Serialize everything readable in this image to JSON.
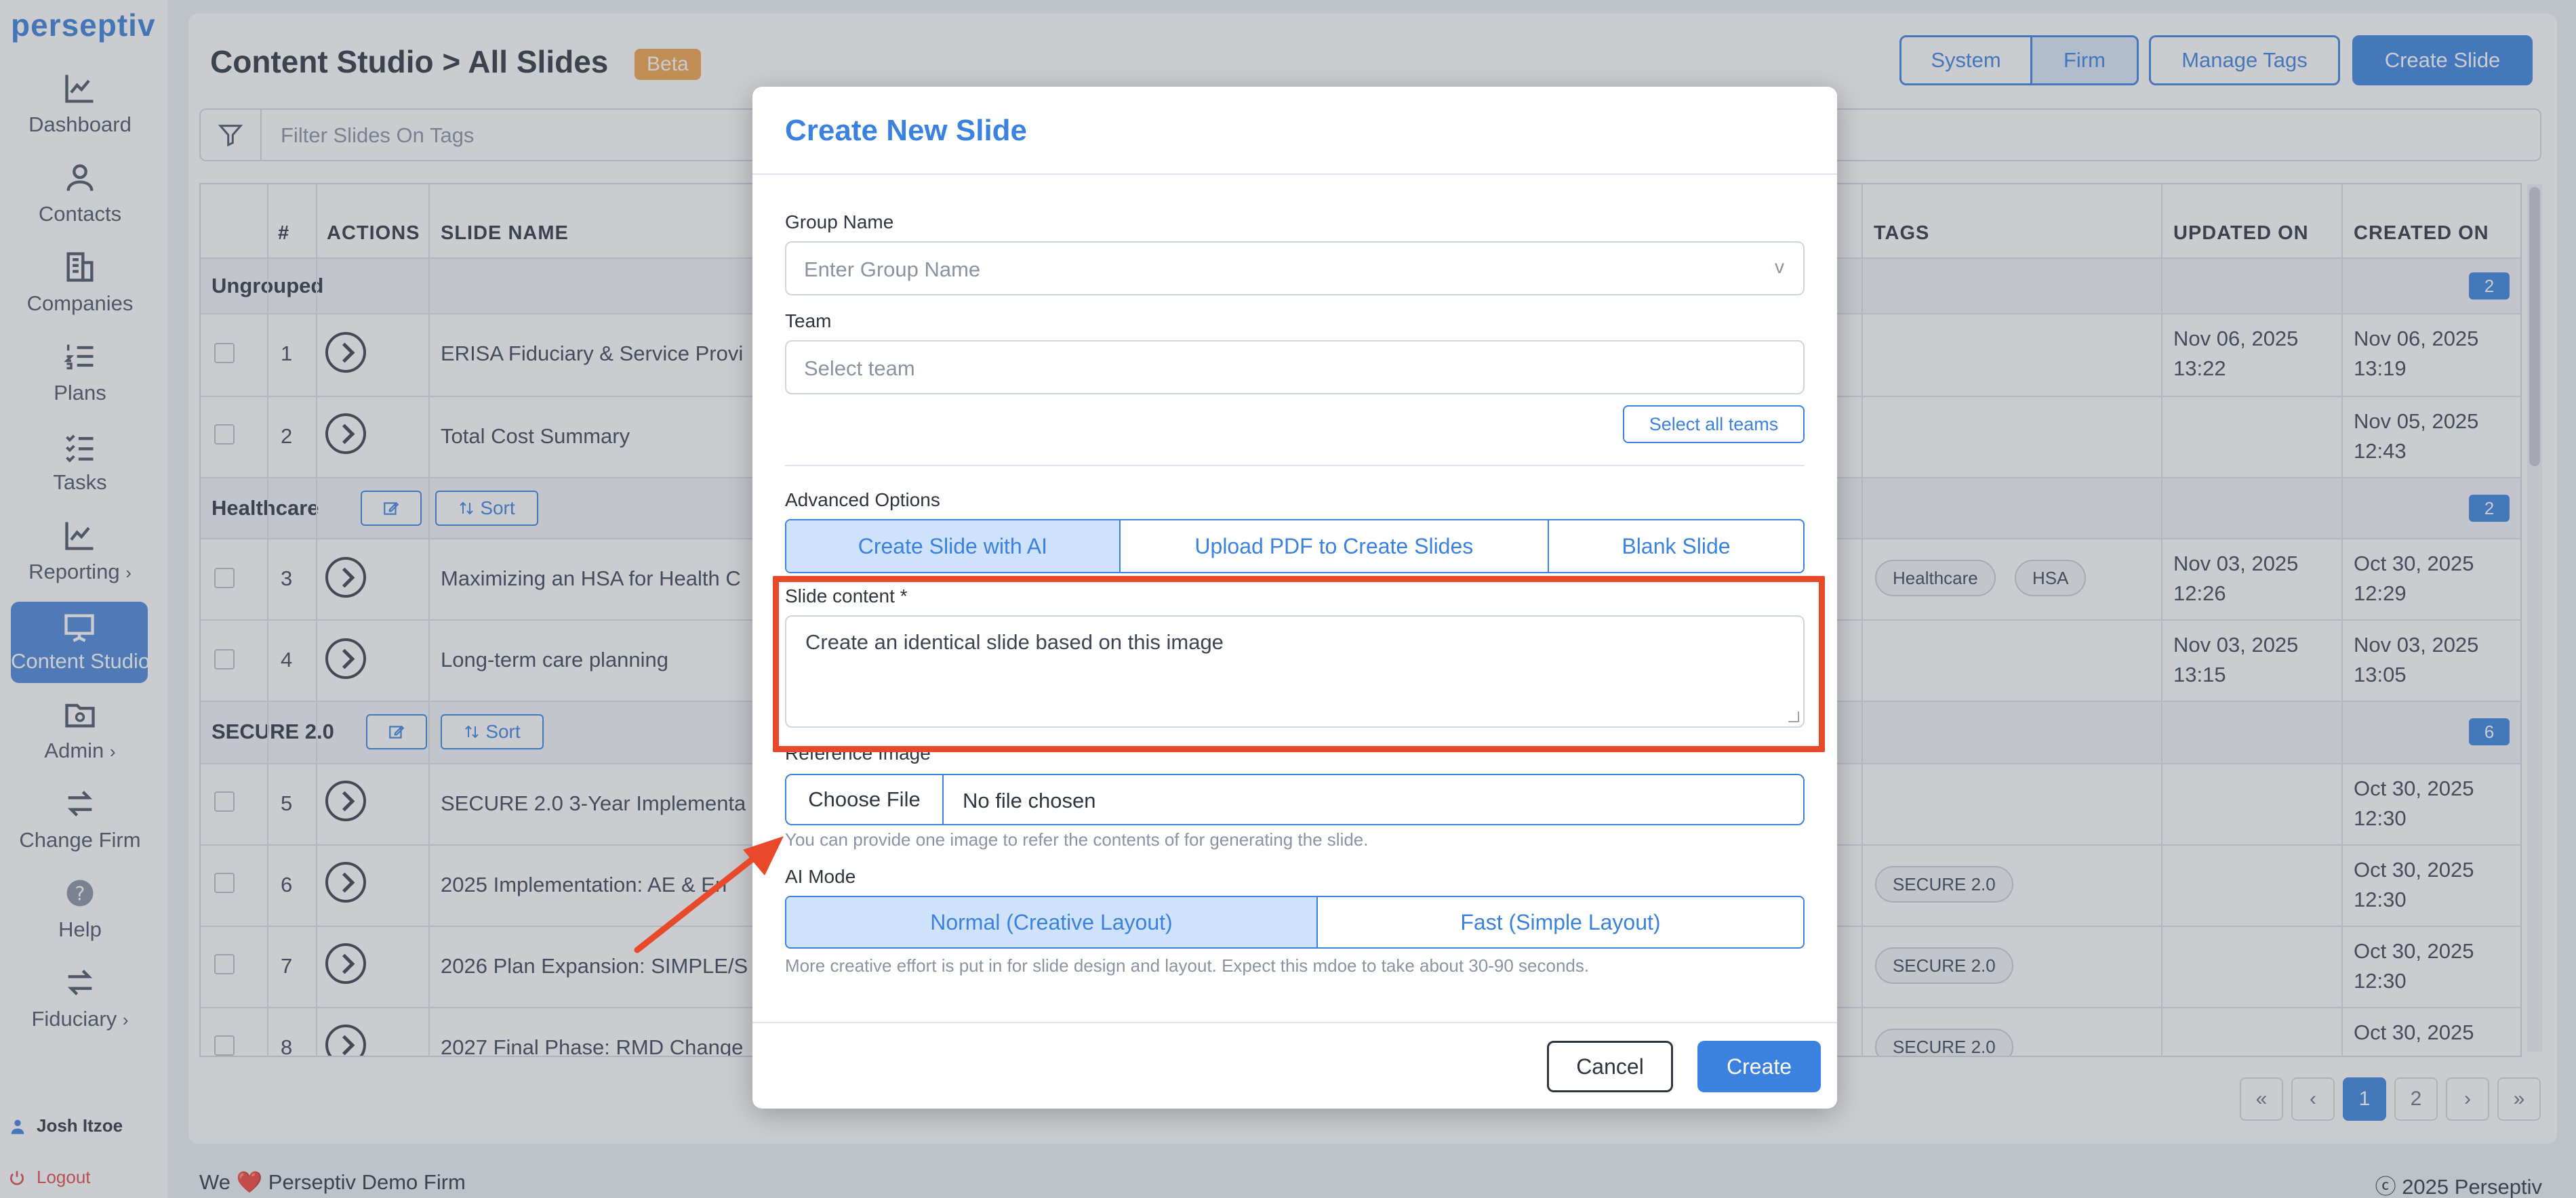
{
  "sidebar": {
    "logo": "perseptiv",
    "items": [
      {
        "label": "Dashboard",
        "icon": "chart-line-icon",
        "chevron": ""
      },
      {
        "label": "Contacts",
        "icon": "user-icon",
        "chevron": ""
      },
      {
        "label": "Companies",
        "icon": "building-icon",
        "chevron": ""
      },
      {
        "label": "Plans",
        "icon": "list-numbered-icon",
        "chevron": ""
      },
      {
        "label": "Tasks",
        "icon": "checklist-icon",
        "chevron": ""
      },
      {
        "label": "Reporting",
        "icon": "chart-line-icon",
        "chevron": "›"
      },
      {
        "label": "Content Studio",
        "icon": "presentation-icon",
        "chevron": ""
      },
      {
        "label": "Admin",
        "icon": "folder-gear-icon",
        "chevron": "›"
      },
      {
        "label": "Change Firm",
        "icon": "swap-arrows-icon",
        "chevron": ""
      },
      {
        "label": "Help",
        "icon": "question-circle-icon",
        "chevron": ""
      },
      {
        "label": "Fiduciary",
        "icon": "swap-arrows-icon",
        "chevron": "›"
      }
    ],
    "user": "Josh Itzoe",
    "logout": "Logout"
  },
  "header": {
    "title": "Content Studio > All Slides",
    "badge": "Beta",
    "buttons": {
      "system": "System",
      "firm": "Firm",
      "manage_tags": "Manage Tags",
      "create_slide": "Create Slide"
    }
  },
  "filter": {
    "placeholder": "Filter Slides On Tags"
  },
  "table": {
    "columns": {
      "num": "#",
      "actions": "ACTIONS",
      "slide_name": "SLIDE NAME",
      "tags": "TAGS",
      "updated_on": "UPDATED ON",
      "created_on": "CREATED ON"
    },
    "groups": [
      {
        "name": "Ungrouped",
        "count": "2"
      },
      {
        "name": "Healthcare",
        "count": "2",
        "sort": "Sort"
      },
      {
        "name": "SECURE 2.0",
        "count": "6",
        "sort": "Sort"
      }
    ],
    "rows": [
      {
        "num": "1",
        "name": "ERISA Fiduciary & Service Provi",
        "tags": [],
        "updated": [
          "Nov 06, 2025",
          "13:22"
        ],
        "created": [
          "Nov 06, 2025",
          "13:19"
        ]
      },
      {
        "num": "2",
        "name": "Total Cost Summary",
        "tags": [],
        "updated": [
          "",
          ""
        ],
        "created": [
          "Nov 05, 2025",
          "12:43"
        ]
      },
      {
        "num": "3",
        "name": "Maximizing an HSA for Health C",
        "tags": [
          "Healthcare",
          "HSA"
        ],
        "updated": [
          "Nov 03, 2025",
          "12:26"
        ],
        "created": [
          "Oct 30, 2025",
          "12:29"
        ]
      },
      {
        "num": "4",
        "name": "Long-term care planning",
        "tags": [],
        "updated": [
          "Nov 03, 2025",
          "13:15"
        ],
        "created": [
          "Nov 03, 2025",
          "13:05"
        ]
      },
      {
        "num": "5",
        "name": "SECURE 2.0 3-Year Implementa",
        "tags": [],
        "updated": [
          "",
          ""
        ],
        "created": [
          "Oct 30, 2025",
          "12:30"
        ]
      },
      {
        "num": "6",
        "name": "2025 Implementation: AE & En",
        "tags": [
          "SECURE 2.0"
        ],
        "updated": [
          "",
          ""
        ],
        "created": [
          "Oct 30, 2025",
          "12:30"
        ]
      },
      {
        "num": "7",
        "name": "2026 Plan Expansion: SIMPLE/S",
        "tags": [
          "SECURE 2.0"
        ],
        "updated": [
          "",
          ""
        ],
        "created": [
          "Oct 30, 2025",
          "12:30"
        ]
      },
      {
        "num": "8",
        "name": "2027 Final Phase: RMD Change",
        "tags": [
          "SECURE 2.0"
        ],
        "updated": [
          "",
          ""
        ],
        "created": [
          "Oct 30, 2025",
          ""
        ]
      }
    ]
  },
  "pagination": {
    "first": "«",
    "prev": "‹",
    "pages": [
      "1",
      "2"
    ],
    "next": "›",
    "last": "»"
  },
  "footer": {
    "left": "We ❤️ Perseptiv Demo Firm",
    "right": "ⓒ 2025 Perseptiv"
  },
  "modal": {
    "title": "Create New Slide",
    "group_label": "Group Name",
    "group_placeholder": "Enter Group Name",
    "group_caret": "v",
    "team_label": "Team",
    "team_placeholder": "Select team",
    "select_all_teams": "Select all teams",
    "advanced_label": "Advanced Options",
    "advanced_options": [
      "Create Slide with AI",
      "Upload PDF to Create Slides",
      "Blank Slide"
    ],
    "slide_content_label": "Slide content *",
    "slide_content_value": "Create an identical slide based on this image",
    "reference_label": "Reference Image",
    "choose_file": "Choose File",
    "no_file": "No file chosen",
    "reference_hint": "You can provide one image to refer the contents of for generating the slide.",
    "ai_mode_label": "AI Mode",
    "ai_modes": [
      "Normal (Creative Layout)",
      "Fast (Simple Layout)"
    ],
    "ai_mode_hint": "More creative effort is put in for slide design and layout. Expect this mdoe to take about 30-90 seconds.",
    "cancel": "Cancel",
    "create": "Create"
  },
  "colors": {
    "accent": "#3b82e0",
    "highlight": "#e8492b",
    "badge": "#f0a24a"
  }
}
